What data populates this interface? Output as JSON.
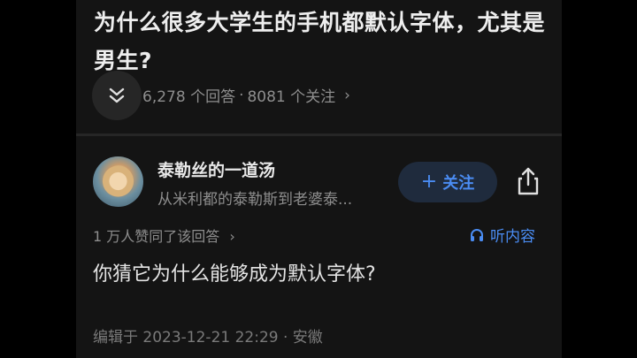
{
  "question": {
    "title": "为什么很多大学生的手机都默认字体，尤其是男生?",
    "answers_count": "6,278 个回答",
    "separator": "·",
    "followers_count": "8081 个关注"
  },
  "answer": {
    "author_name": "泰勒丝的一道汤",
    "author_desc": "从米利都的泰勒斯到老婆泰...",
    "follow_label": "关注",
    "likes_text": "1 万人赞同了该回答",
    "listen_label": "听内容",
    "content": "你猜它为什么能够成为默认字体?",
    "edit_info": "编辑于 2023-12-21 22:29 · 安徽"
  },
  "icons": {
    "collapse": "double-chevron-down-icon",
    "share": "share-icon",
    "listen": "headphones-icon",
    "arrow": "chevron-right-icon"
  },
  "colors": {
    "background": "#141414",
    "accent": "#4a8cf2",
    "text_primary": "#eeeeee",
    "text_secondary": "#8e8e8e"
  }
}
